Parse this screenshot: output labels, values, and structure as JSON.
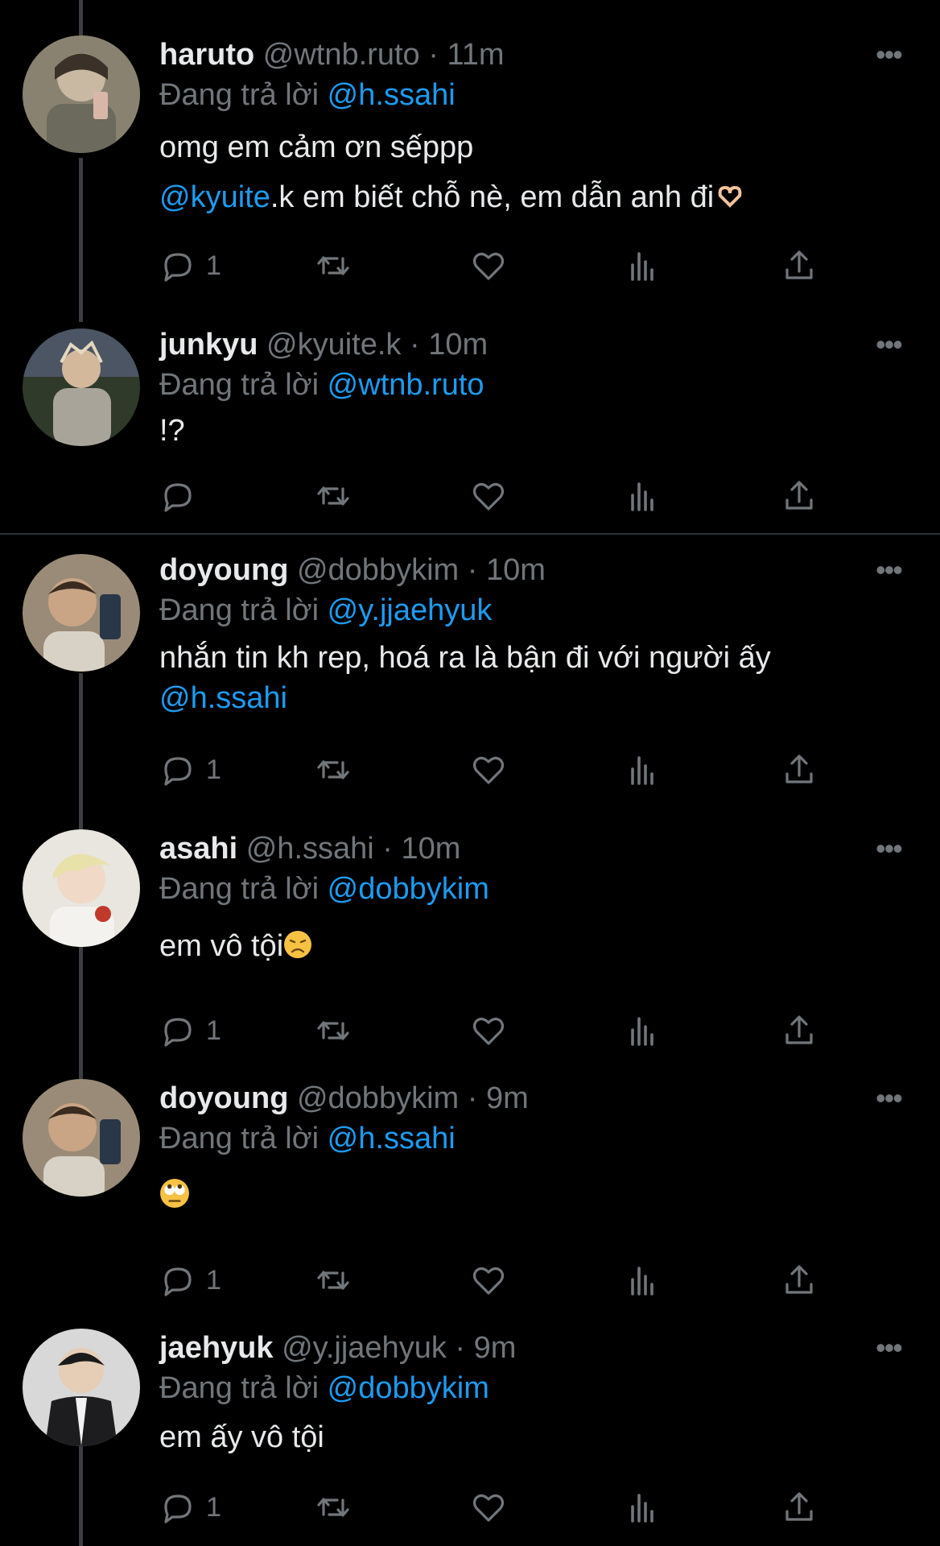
{
  "tweets": [
    {
      "name": "haruto",
      "handle": "@wtnb.ruto",
      "time": "11m",
      "reply_prefix": "Đang trả lời",
      "reply_to": "@h.ssahi",
      "line1": "omg em cảm ơn sếppp",
      "line2_mention": "@kyuite",
      "line2_text": ".k em biết chỗ nè, em dẫn anh đi",
      "reply_count": "1"
    },
    {
      "name": "junkyu",
      "handle": "@kyuite.k",
      "time": "10m",
      "reply_prefix": "Đang trả lời",
      "reply_to": "@wtnb.ruto",
      "line1": "!?",
      "reply_count": ""
    },
    {
      "name": "doyoung",
      "handle": "@dobbykim",
      "time": "10m",
      "reply_prefix": "Đang trả lời",
      "reply_to": "@y.jjaehyuk",
      "line1": "nhắn tin kh rep, hoá ra là bận đi với người ấy",
      "line2_mention": "@h.ssahi",
      "reply_count": "1"
    },
    {
      "name": "asahi",
      "handle": "@h.ssahi",
      "time": "10m",
      "reply_prefix": "Đang trả lời",
      "reply_to": "@dobbykim",
      "line1": "em vô tội",
      "reply_count": "1"
    },
    {
      "name": "doyoung",
      "handle": "@dobbykim",
      "time": "9m",
      "reply_prefix": "Đang trả lời",
      "reply_to": "@h.ssahi",
      "line1": "",
      "reply_count": "1"
    },
    {
      "name": "jaehyuk",
      "handle": "@y.jjaehyuk",
      "time": "9m",
      "reply_prefix": "Đang trả lời",
      "reply_to": "@dobbykim",
      "line1": "em ấy vô tội",
      "reply_count": "1"
    }
  ],
  "dot_separator": "·",
  "more_label": "•••",
  "icons": [
    "reply-icon",
    "retweet-icon",
    "like-icon",
    "views-icon",
    "share-icon",
    "more-icon"
  ],
  "colors": {
    "background": "#000000",
    "text": "#e7e9ea",
    "muted": "#71767b",
    "mention": "#1d9bf0"
  }
}
